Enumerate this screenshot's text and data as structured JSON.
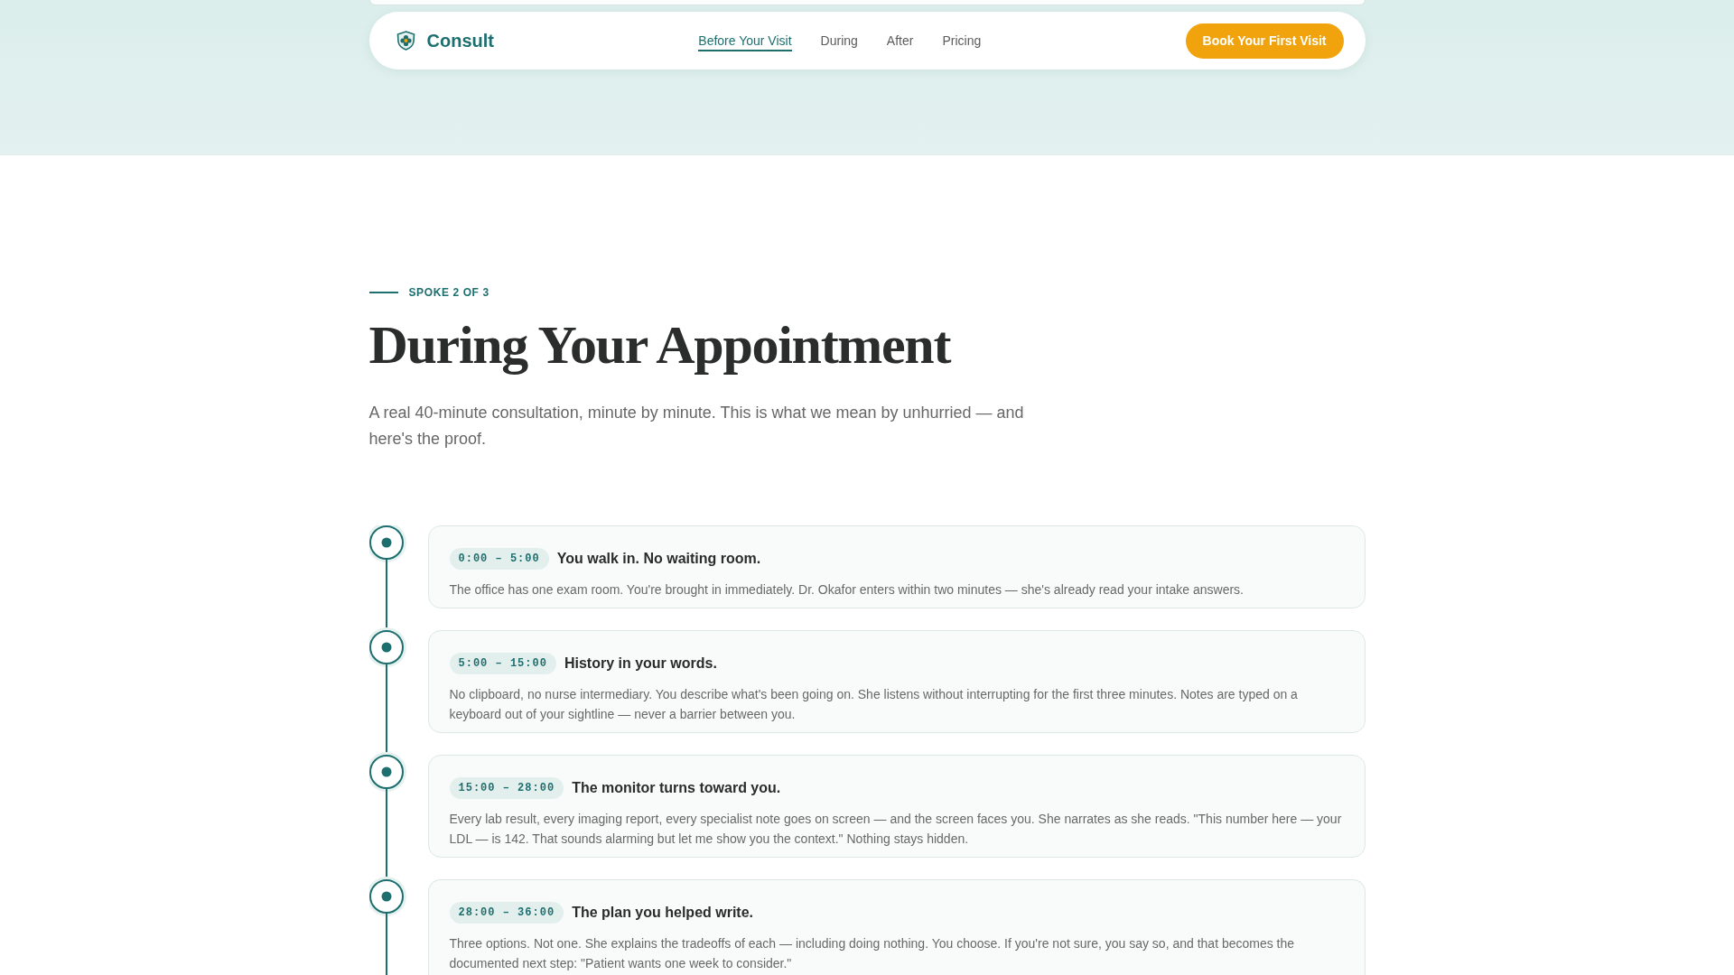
{
  "nav": {
    "logo": "Consult",
    "links": [
      {
        "label": "Before Your Visit",
        "selected": true
      },
      {
        "label": "During",
        "selected": false
      },
      {
        "label": "After",
        "selected": false
      },
      {
        "label": "Pricing",
        "selected": false
      }
    ],
    "cta": "Book Your First Visit"
  },
  "intro": {
    "eyebrow": "SPOKE 2 OF 3",
    "title": "During Your Appointment",
    "subtitle": "A real 40-minute consultation, minute by minute. This is what we mean by unhurried — and here's the proof."
  },
  "timeline": [
    {
      "time": "0:00 – 5:00",
      "title": "You walk in. No waiting room.",
      "text": "The office has one exam room. You're brought in immediately. Dr. Okafor enters within two minutes — she's already read your intake answers."
    },
    {
      "time": "5:00 – 15:00",
      "title": "History in your words.",
      "text": "No clipboard, no nurse intermediary. You describe what's been going on. She listens without interrupting for the first three minutes. Notes are typed on a keyboard out of your sightline — never a barrier between you."
    },
    {
      "time": "15:00 – 28:00",
      "title": "The monitor turns toward you.",
      "text": "Every lab result, every imaging report, every specialist note goes on screen — and the screen faces you. She narrates as she reads. \"This number here — your LDL — is 142. That sounds alarming but let me show you the context.\" Nothing stays hidden."
    },
    {
      "time": "28:00 – 36:00",
      "title": "The plan you helped write.",
      "text": "Three options. Not one. She explains the tradeoffs of each — including doing nothing. You choose. If you're not sure, you say so, and that becomes the documented next step: \"Patient wants one week to consider.\""
    }
  ]
}
